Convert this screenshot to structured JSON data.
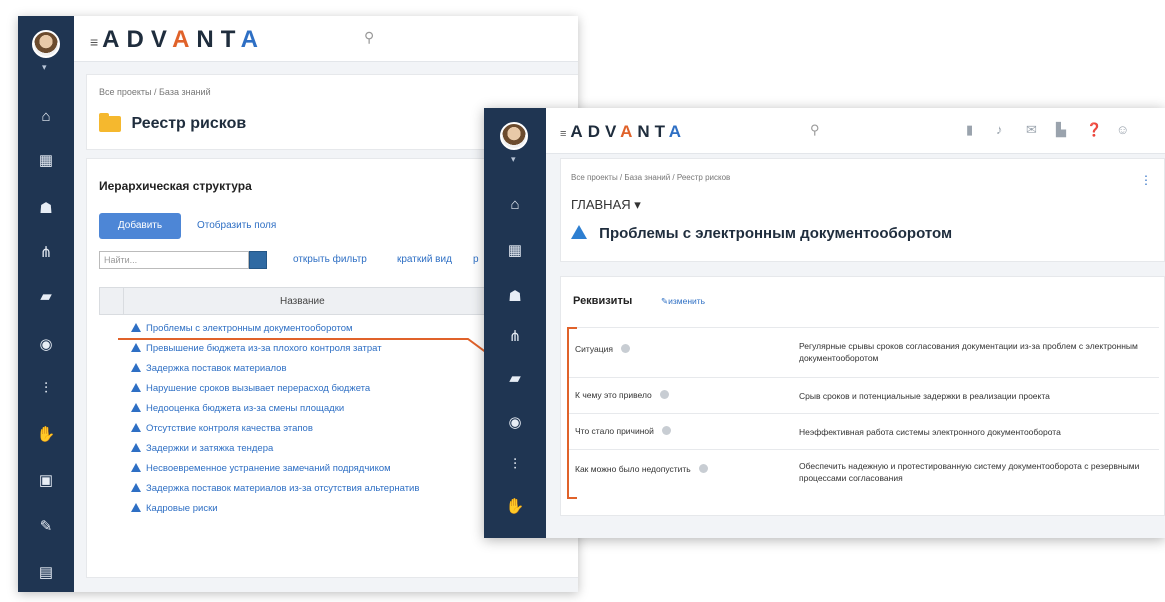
{
  "brand": {
    "name": "ADVANTA"
  },
  "back_window": {
    "breadcrumb": "Все проекты / База знаний",
    "title": "Реестр рисков",
    "section_title": "Иерархическая структура",
    "add_button": "Добавить",
    "show_fields_link": "Отобразить поля",
    "search_placeholder": "Найти...",
    "links": [
      "открыть фильтр",
      "краткий вид",
      "р"
    ],
    "table_header": "Название",
    "items": [
      "Проблемы с электронным документооборотом",
      "Превышение бюджета из-за плохого контроля затрат",
      "Задержка поставок материалов",
      "Нарушение сроков вызывает перерасход бюджета",
      "Недооценка бюджета из-за смены площадки",
      "Отсутствие контроля качества этапов",
      "Задержки и затяжка тендера",
      "Несвоевременное устранение замечаний подрядчиком",
      "Задержка поставок материалов из-за отсутствия альтернатив",
      "Кадровые риски"
    ]
  },
  "front_window": {
    "breadcrumb": "Все проекты / База знаний / Реестр рисков",
    "main_tab": "ГЛАВНАЯ ▾",
    "title": "Проблемы с электронным документооборотом",
    "section_title": "Реквизиты",
    "edit_link": "изменить",
    "rows": [
      {
        "label": "Ситуация",
        "value": "Регулярные срывы сроков согласования документации из-за проблем с электронным документооборотом"
      },
      {
        "label": "К чему это привело",
        "value": "Срыв сроков и потенциальные задержки в реализации проекта"
      },
      {
        "label": "Что стало причиной",
        "value": "Неэффективная работа системы электронного документооборота"
      },
      {
        "label": "Как можно было недопустить",
        "value": "Обеспечить надежную и протестированную систему документооборота с резервными процессами согласования"
      }
    ]
  },
  "colors": {
    "sidebar": "#1f3552",
    "accent": "#e0622a",
    "link": "#2e6fc4",
    "button": "#4d86d6"
  },
  "icons": [
    "home-icon",
    "calendar-icon",
    "users-icon",
    "hierarchy-icon",
    "chat-icon",
    "circle-icon",
    "chart-icon",
    "hand-icon",
    "briefcase-icon",
    "edit-icon",
    "calendar-icon",
    "search-icon",
    "bookmark-icon",
    "bell-icon",
    "mail-icon",
    "thumbs-icon",
    "help-icon",
    "user-icon",
    "kebab-icon"
  ]
}
